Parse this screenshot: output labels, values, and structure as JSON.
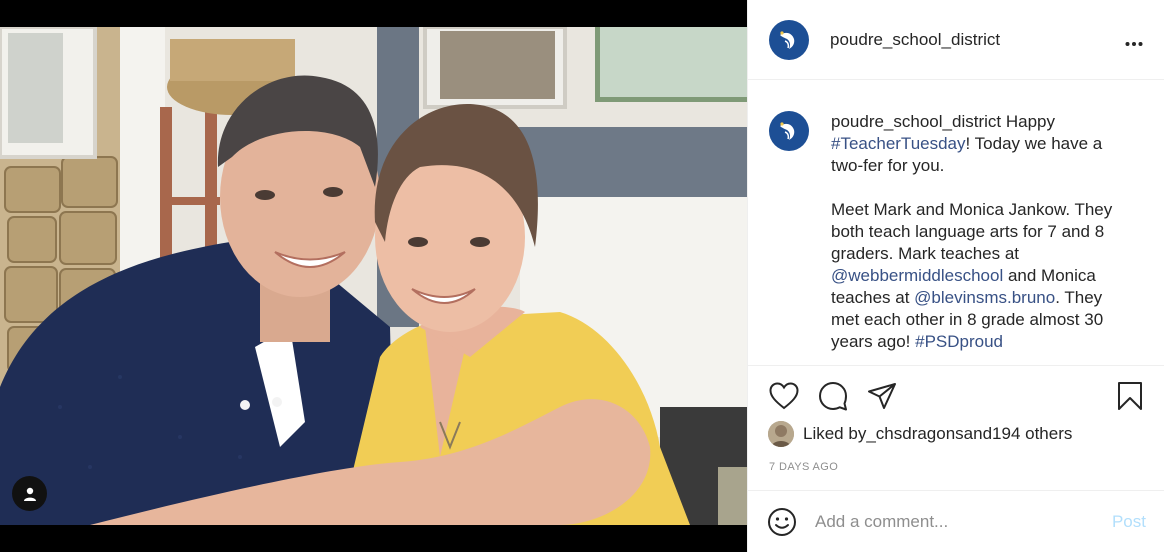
{
  "post": {
    "username": "poudre_school_district",
    "more_label": "•••",
    "caption": {
      "username": "poudre_school_district",
      "p1_text1": " Happy ",
      "hashtag1": "#TeacherTuesday",
      "p1_text2": "! Today we have a two-fer for you.",
      "p2_text1": "Meet Mark and Monica Jankow. They both teach language arts for 7 and 8 graders. Mark teaches at ",
      "mention1": "@webbermiddleschool",
      "p2_text2": " and Monica teaches at ",
      "mention2": "@blevinsms.bruno",
      "p2_text3": ". They met each other in 8 grade almost 30 years ago! ",
      "hashtag2": "#PSDproud"
    },
    "likes": {
      "prefix": "Liked by ",
      "user": "_chsdragons",
      "middle": " and ",
      "others": "194 others"
    },
    "time_ago": "7 DAYS AGO",
    "comment": {
      "placeholder": "Add a comment...",
      "post_label": "Post"
    }
  },
  "icons": [
    "user-tag-icon",
    "heart-icon",
    "comment-icon",
    "share-icon",
    "bookmark-icon",
    "emoji-icon",
    "more-icon"
  ],
  "colors": {
    "link": "#385185",
    "muted": "#8e8e8e",
    "post_disabled": "#b2dffc",
    "avatar": "#1d4f95",
    "border": "#efefef"
  }
}
